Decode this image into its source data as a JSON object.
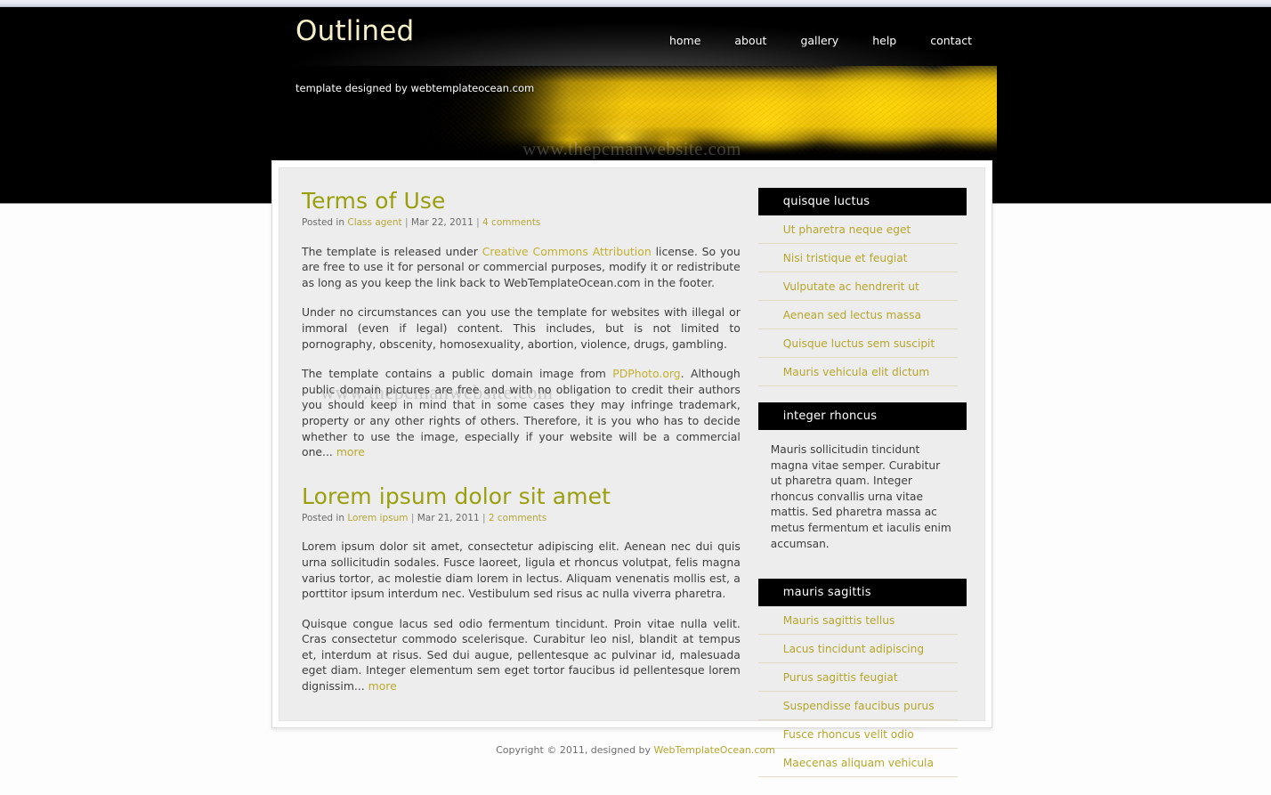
{
  "site": {
    "logo": "Outlined",
    "banner_caption": "template designed by webtemplateocean.com",
    "watermark": "www.thepcmanwebsite.com"
  },
  "nav": {
    "items": [
      {
        "label": "home"
      },
      {
        "label": "about"
      },
      {
        "label": "gallery"
      },
      {
        "label": "help"
      },
      {
        "label": "contact"
      }
    ]
  },
  "posts": [
    {
      "title": "Terms of Use",
      "meta": {
        "posted_in_label": "Posted in",
        "category": "Class agent",
        "date": "Mar 22, 2011",
        "comments": "4 comments",
        "separator": "|"
      },
      "paragraphs": [
        {
          "before": "The template is released under ",
          "link": "Creative Commons Attribution",
          "after": " license. So you are free to use it for personal or commercial purposes, modify it or redistribute as long as you keep the link back to WebTemplateOcean.com in the footer."
        },
        {
          "before": "Under no circumstances can you use the template for websites with illegal or immoral (even if legal) content. This includes, but is not limited to pornography, obscenity, homosexuality, abortion, violence, drugs, gambling.",
          "link": "",
          "after": ""
        },
        {
          "before": "The template contains a public domain image from ",
          "link": "PDPhoto.org",
          "after": ". Although public domain pictures are free and with no obligation to credit their authors you should keep in mind that in some cases they may infringe trademark, property or any other rights of others. Therefore, it is you who has to decide whether to use the image, especially if your website will be a commercial one... ",
          "more": "more"
        }
      ]
    },
    {
      "title": "Lorem ipsum dolor sit amet",
      "meta": {
        "posted_in_label": "Posted in",
        "category": "Lorem ipsum",
        "date": "Mar 21, 2011",
        "comments": "2 comments",
        "separator": "|"
      },
      "paragraphs": [
        {
          "before": "Lorem ipsum dolor sit amet, consectetur adipiscing elit. Aenean nec dui quis urna sollicitudin sodales. Fusce laoreet, ligula et rhoncus volutpat, felis magna varius tortor, ac molestie diam lorem in lectus. Aliquam venenatis mollis est, a porttitor ipsum interdum nec. Vestibulum sed risus ac nulla viverra pharetra.",
          "link": "",
          "after": ""
        },
        {
          "before": "Quisque congue lacus sed odio fermentum tincidunt. Proin vitae nulla velit. Cras consectetur commodo scelerisque. Curabitur leo nisl, blandit at tempus et, interdum at risus. Sed dui augue, pellentesque ac pulvinar id, malesuada eget diam. Integer elementum sem eget tortor faucibus id pellentesque lorem dignissim... ",
          "link": "",
          "after": "",
          "more": "more"
        }
      ]
    }
  ],
  "sidebar": {
    "widgets": [
      {
        "type": "list",
        "title": "quisque luctus",
        "items": [
          {
            "label": "Ut pharetra neque eget"
          },
          {
            "label": "Nisi tristique et feugiat"
          },
          {
            "label": "Vulputate ac hendrerit ut"
          },
          {
            "label": "Aenean sed lectus massa"
          },
          {
            "label": "Quisque luctus sem suscipit"
          },
          {
            "label": "Mauris vehicula elit dictum"
          }
        ]
      },
      {
        "type": "text",
        "title": "integer rhoncus",
        "text": "Mauris sollicitudin tincidunt magna vitae semper. Curabitur ut pharetra quam. Integer rhoncus convallis urna vitae mattis. Sed pharetra massa ac metus fermentum et iaculis enim accumsan."
      },
      {
        "type": "list",
        "title": "mauris sagittis",
        "items": [
          {
            "label": "Mauris sagittis tellus"
          },
          {
            "label": "Lacus tincidunt adipiscing"
          },
          {
            "label": "Purus sagittis feugiat"
          },
          {
            "label": "Suspendisse faucibus purus"
          },
          {
            "label": "Fusce rhoncus velit odio"
          },
          {
            "label": "Maecenas aliquam vehicula"
          }
        ]
      }
    ]
  },
  "footer": {
    "copyright": "Copyright © 2011, designed by ",
    "link": "WebTemplateOcean.com"
  },
  "colors": {
    "accent": "#b5a62c",
    "heading": "#9aa00d",
    "logo": "#f6f0c8",
    "header_bg": "#000000",
    "content_bg": "#ededed"
  }
}
